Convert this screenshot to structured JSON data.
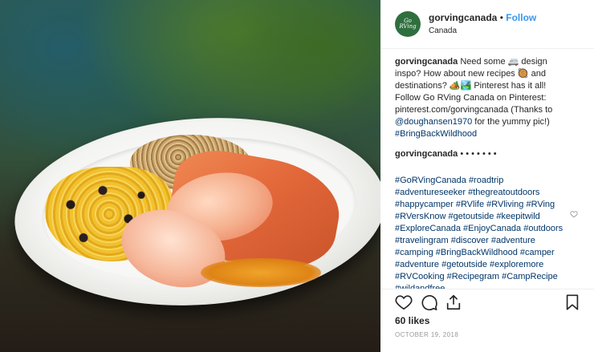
{
  "post": {
    "username": "gorvingcanada",
    "separator": "•",
    "follow_label": "Follow",
    "location": "Canada",
    "avatar_text": "Go RVing",
    "caption": {
      "username": "gorvingcanada",
      "part1": "Need some 🚐 design inspo? How about new recipes 🥘 and destinations? 🏕️🏞️ Pinterest has it all! Follow Go RVing Canada on Pinterest: pinterest.com/gorvingcanada (Thanks to ",
      "mention": "@doughansen1970",
      "part2": " for the yummy pic!) ",
      "hashtag": "#BringBackWildhood"
    },
    "comment2": {
      "username": "gorvingcanada",
      "text": "• • • • • • •"
    },
    "hashtags": "#GoRVingCanada #roadtrip #adventureseeker #thegreatoutdoors #happycamper #RVlife #RVliving #RVing #RVersKnow #getoutside #keepitwild #ExploreCanada #EnjoyCanada #outdoors #travelingram #discover #adventure #camping #BringBackWildhood #camper #adventure #getoutside #exploremore #RVCooking #Recipegram #CampRecipe #wildandfree",
    "likes": "60 likes",
    "date": "OCTOBER 19, 2018"
  },
  "icons": {
    "like": "heart-icon",
    "comment": "comment-icon",
    "share": "share-icon",
    "save": "bookmark-icon"
  },
  "colors": {
    "link": "#003569",
    "follow": "#3897f0"
  }
}
